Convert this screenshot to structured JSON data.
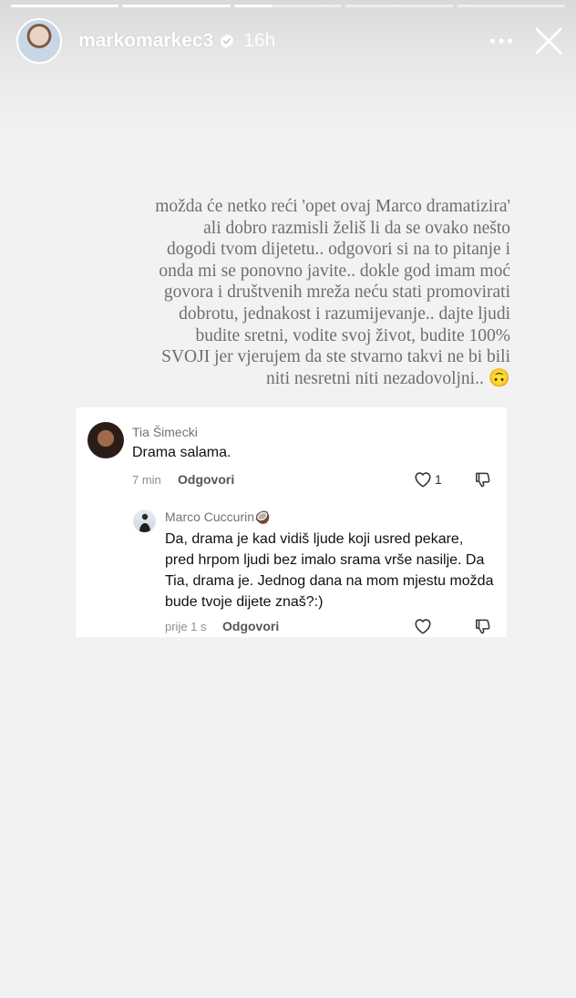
{
  "story": {
    "progress_fill": [
      1,
      1,
      0.35,
      0,
      0
    ],
    "username": "markomarkec3",
    "time_ago": "16h",
    "more_icon": "more-horizontal-icon",
    "close_icon": "close-icon",
    "caption": "možda će netko reći 'opet ovaj Marco dramatizira' ali dobro razmisli želiš li da se ovako nešto dogodi tvom dijetetu.. odgovori si na to pitanje i onda mi se ponovno javite.. dokle god imam moć govora i društvenih mreža neću stati promovirati dobrotu, jednakost i razumijevanje.. dajte ljudi budite sretni, vodite svoj život, budite 100% SVOJI jer vjerujem da ste stvarno takvi ne bi bili niti nesretni niti nezadovoljni.. 🙃"
  },
  "comments": [
    {
      "author": "Tia Šimecki",
      "text": "Drama salama.",
      "time": "7 min",
      "reply_label": "Odgovori",
      "likes": "1"
    },
    {
      "author": "Marco Cuccurin🥥",
      "text": "Da, drama je kad vidiš ljude koji usred pekare, pred hrpom ljudi bez imalo srama vrše nasilje. Da Tia, drama je. Jednog dana na mom mjestu možda bude tvoje dijete znaš?:)",
      "time": "prije 1 s",
      "reply_label": "Odgovori"
    }
  ]
}
